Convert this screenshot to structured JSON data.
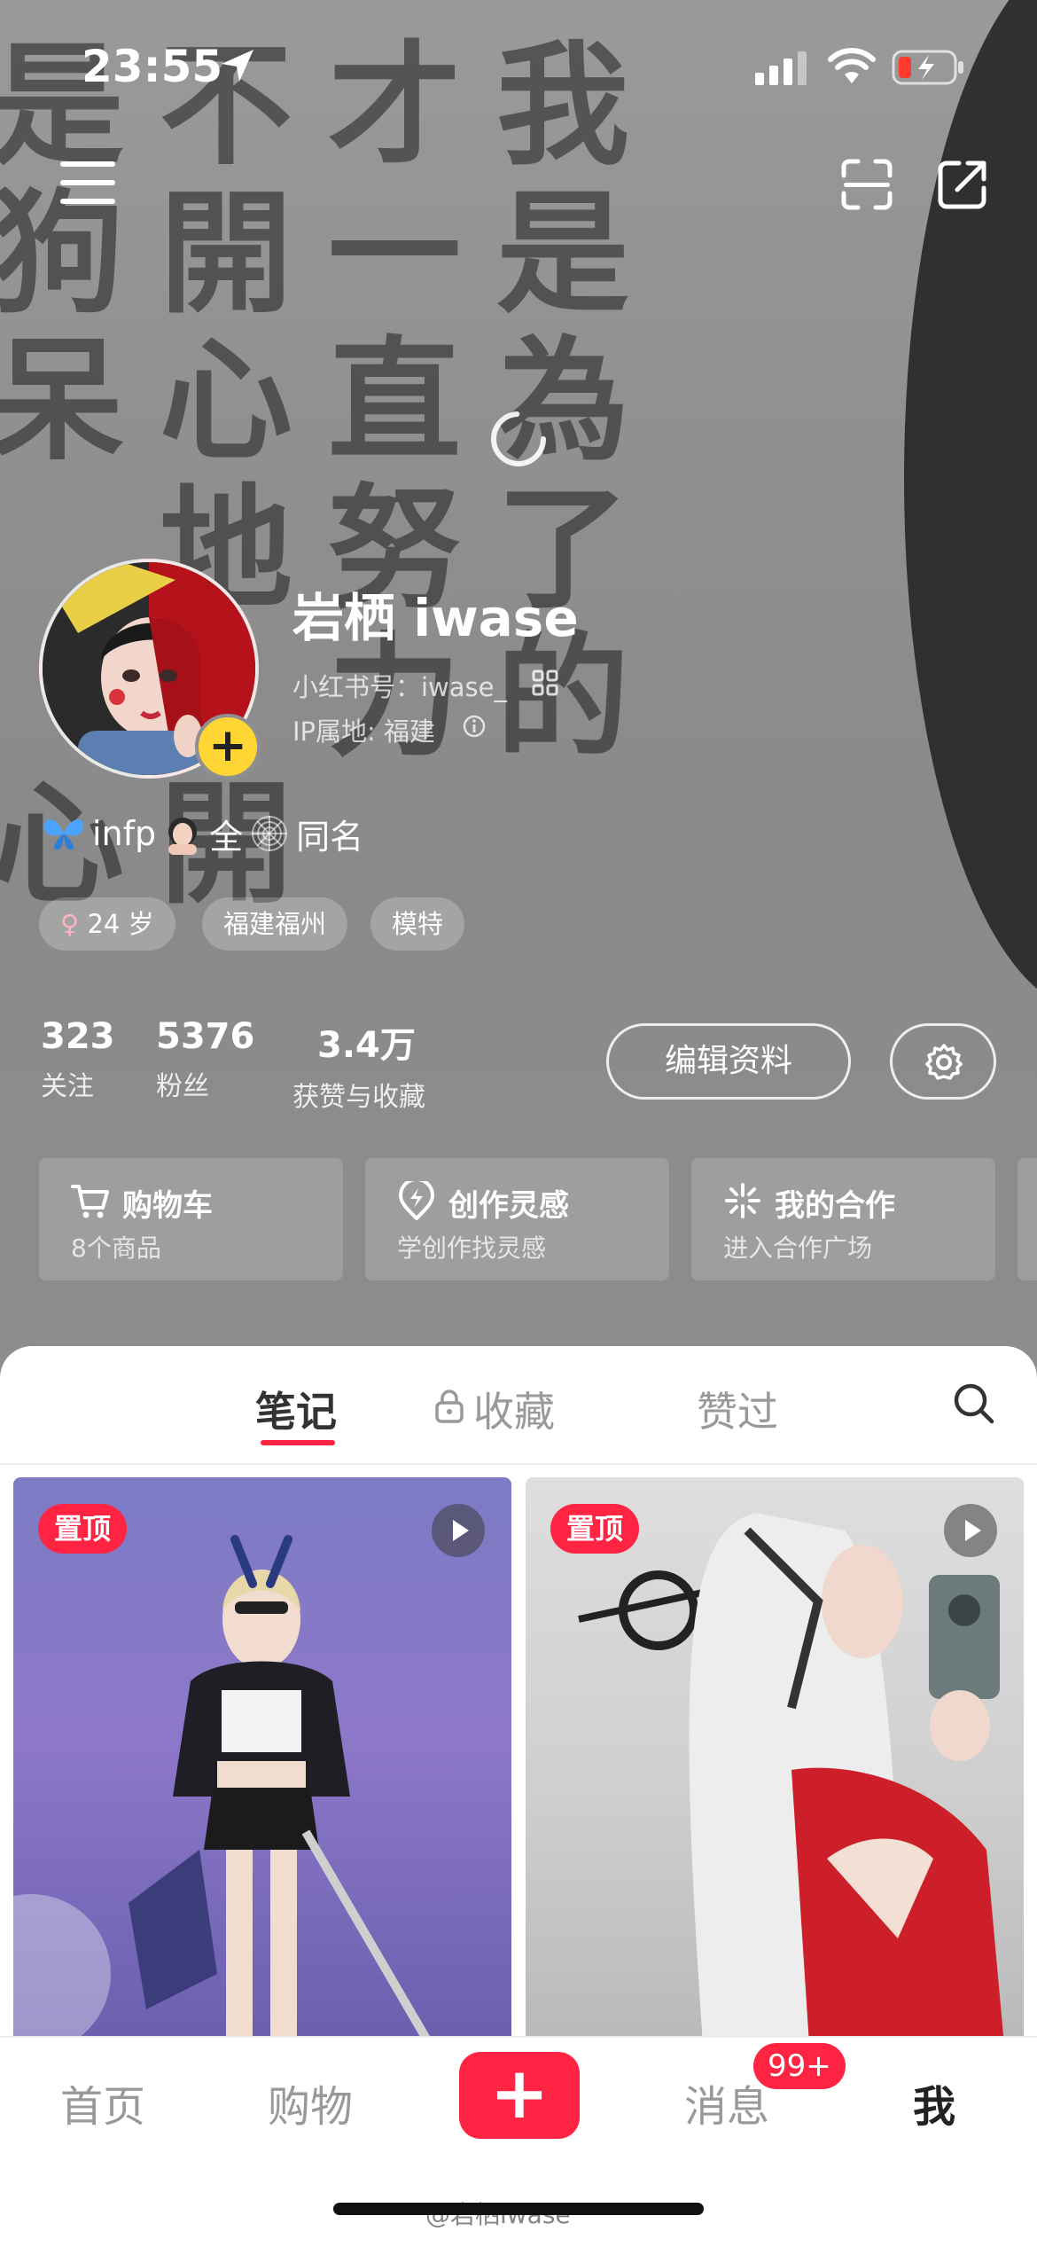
{
  "status_bar": {
    "time": "23:55"
  },
  "background_text": [
    "是",
    "不",
    "才",
    "我",
    "狗",
    "開",
    "一",
    "是",
    "呆",
    "心",
    "直",
    "為",
    "",
    "地",
    "努",
    "了",
    "",
    "",
    "力",
    "的",
    "心",
    "開"
  ],
  "profile": {
    "name": "岩栖 iwase",
    "account_label": "小红书号：iwase_",
    "ip_label": "IP属地: 福建",
    "bio_parts": [
      "infp",
      "全",
      "同名"
    ],
    "tags": [
      "24 岁",
      "福建福州",
      "模特"
    ]
  },
  "stats": [
    {
      "value": "323",
      "label": "关注"
    },
    {
      "value": "5376",
      "label": "粉丝"
    },
    {
      "value": "3.4万",
      "label": "获赞与收藏"
    }
  ],
  "actions": {
    "edit_profile": "编辑资料"
  },
  "cards": [
    {
      "title": "购物车",
      "subtitle": "8个商品",
      "icon": "cart-icon"
    },
    {
      "title": "创作灵感",
      "subtitle": "学创作找灵感",
      "icon": "lightning-icon"
    },
    {
      "title": "我的合作",
      "subtitle": "进入合作广场",
      "icon": "sparkle-icon"
    }
  ],
  "tabs": [
    {
      "label": "笔记",
      "active": true
    },
    {
      "label": "收藏",
      "active": false,
      "locked": true
    },
    {
      "label": "赞过",
      "active": false
    }
  ],
  "notes": [
    {
      "pin_label": "置顶",
      "is_video": true
    },
    {
      "pin_label": "置顶",
      "is_video": true
    }
  ],
  "bottom_nav": {
    "items": [
      "首页",
      "购物",
      "消息",
      "我"
    ],
    "messages_badge": "99+"
  },
  "watermark": "@岩栖iwase",
  "colors": {
    "accent": "#ff2442",
    "avatar_add": "#ffd633"
  }
}
